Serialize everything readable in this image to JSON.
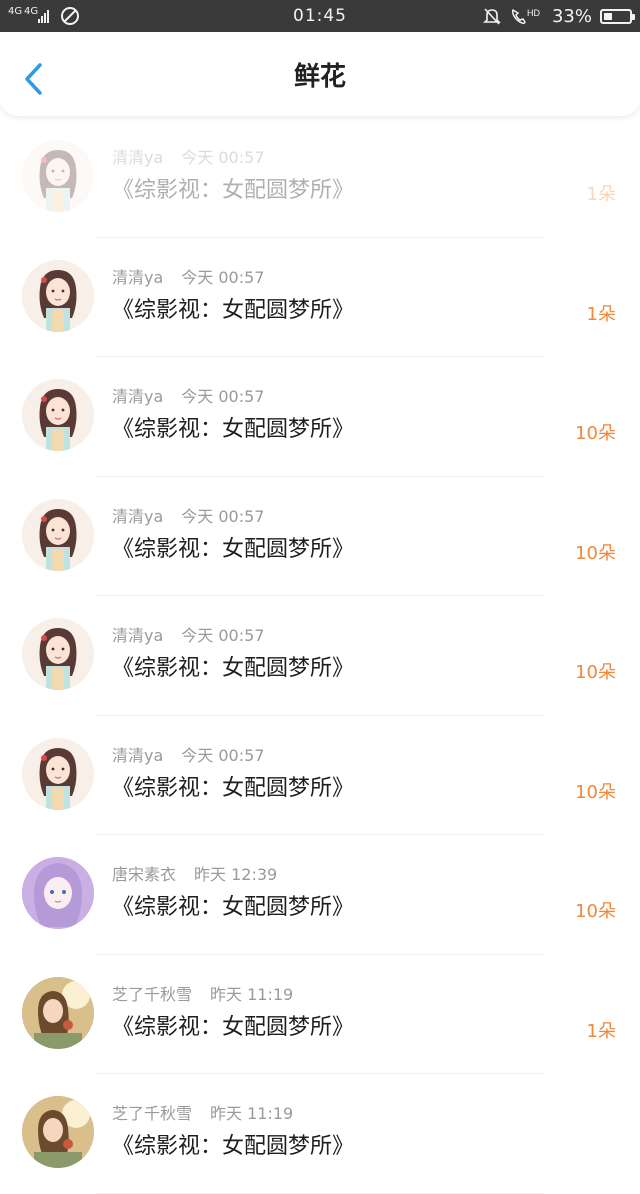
{
  "status_bar": {
    "network_1": "4G",
    "network_2": "4G",
    "time": "01:45",
    "battery_percent": "33%",
    "battery_level": 0.33
  },
  "header": {
    "title": "鲜花"
  },
  "rows": [
    {
      "user": "清清ya",
      "time": "今天  00:57",
      "title": "《综影视：女配圆梦所》",
      "count": "1朵",
      "avatar": "girl"
    },
    {
      "user": "清清ya",
      "time": "今天  00:57",
      "title": "《综影视：女配圆梦所》",
      "count": "1朵",
      "avatar": "girl"
    },
    {
      "user": "清清ya",
      "time": "今天  00:57",
      "title": "《综影视：女配圆梦所》",
      "count": "10朵",
      "avatar": "girl"
    },
    {
      "user": "清清ya",
      "time": "今天  00:57",
      "title": "《综影视：女配圆梦所》",
      "count": "10朵",
      "avatar": "girl"
    },
    {
      "user": "清清ya",
      "time": "今天  00:57",
      "title": "《综影视：女配圆梦所》",
      "count": "10朵",
      "avatar": "girl"
    },
    {
      "user": "清清ya",
      "time": "今天  00:57",
      "title": "《综影视：女配圆梦所》",
      "count": "10朵",
      "avatar": "girl"
    },
    {
      "user": "唐宋素衣",
      "time": "昨天  12:39",
      "title": "《综影视：女配圆梦所》",
      "count": "10朵",
      "avatar": "purple"
    },
    {
      "user": "芝了千秋雪",
      "time": "昨天  11:19",
      "title": "《综影视：女配圆梦所》",
      "count": "1朵",
      "avatar": "photo"
    },
    {
      "user": "芝了千秋雪",
      "time": "昨天  11:19",
      "title": "《综影视：女配圆梦所》",
      "count": "",
      "avatar": "photo"
    }
  ],
  "colors": {
    "accent_blue": "#2f9ae8",
    "count_orange": "#f0883a",
    "status_bar_bg": "#3a3a3a"
  }
}
